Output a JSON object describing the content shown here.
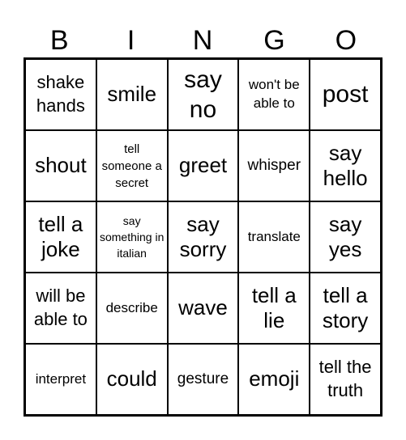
{
  "header": {
    "letters": [
      "B",
      "I",
      "N",
      "G",
      "O"
    ]
  },
  "cells": [
    [
      "shake hands",
      "smile",
      "say no",
      "won't be able to",
      "post"
    ],
    [
      "shout",
      "tell someone a secret",
      "greet",
      "whisper",
      "say hello"
    ],
    [
      "tell a joke",
      "say something in italian",
      "say sorry",
      "translate",
      "say yes"
    ],
    [
      "will be able to",
      "describe",
      "wave",
      "tell a lie",
      "tell a story"
    ],
    [
      "interpret",
      "could",
      "gesture",
      "emoji",
      "tell the truth"
    ]
  ],
  "colors": {
    "text": "#000000",
    "grid_line": "#000000",
    "background": "#ffffff"
  }
}
